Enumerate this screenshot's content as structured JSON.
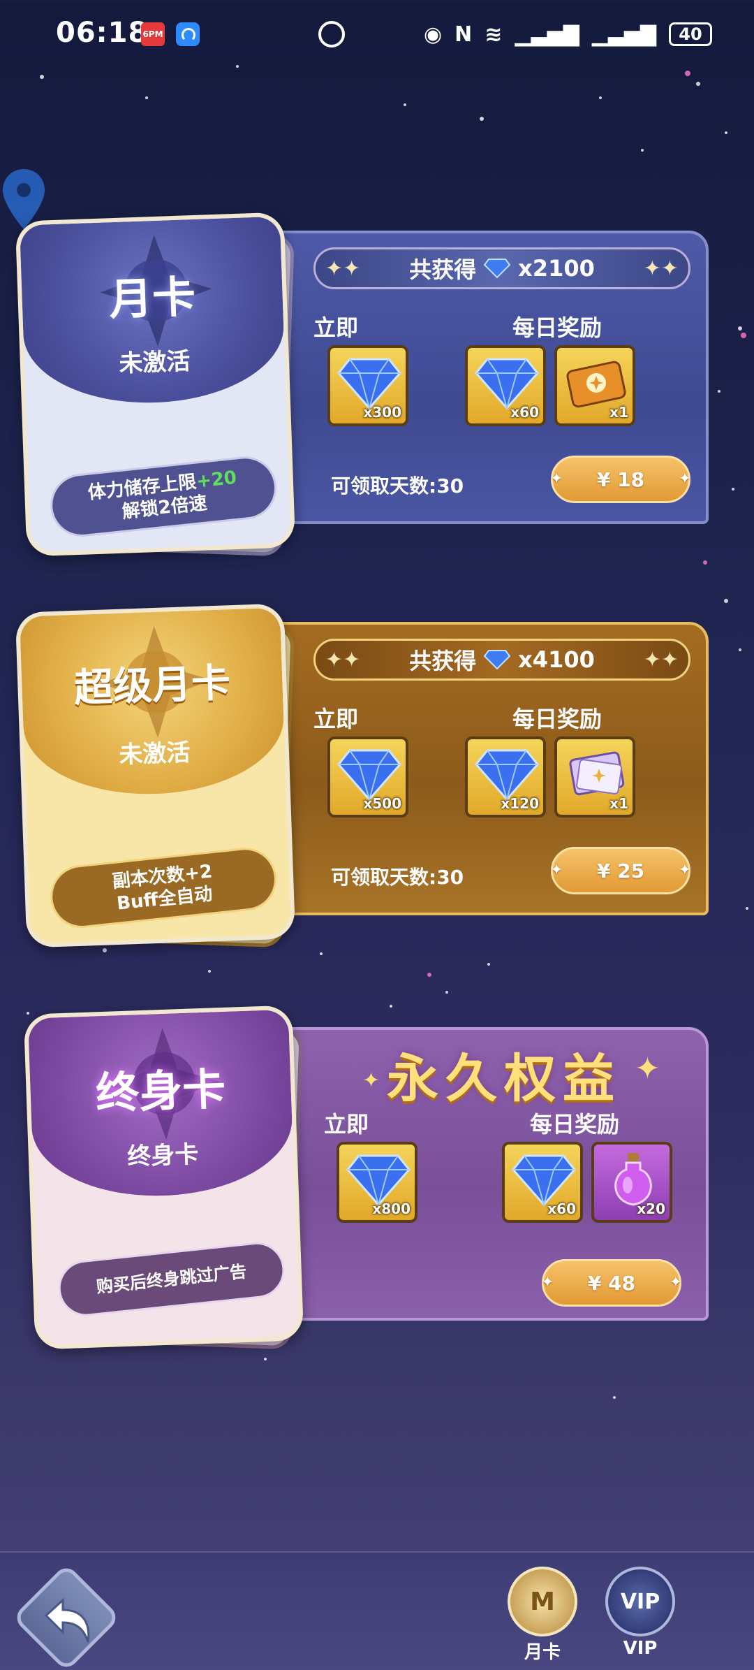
{
  "status_bar": {
    "time": "06:18",
    "battery": "40",
    "icons": [
      "eye-icon",
      "nfc-icon",
      "wifi-icon",
      "signal-4g-icon",
      "signal-4g-icon"
    ]
  },
  "cards": [
    {
      "id": "monthly",
      "title": "月卡",
      "status": "未激活",
      "perk_line1": "体力储存上限",
      "perk_highlight": "+20",
      "perk_line2": "解锁2倍速",
      "total_label": "共获得",
      "total_value": "x2100",
      "instant_label": "立即",
      "daily_label": "每日奖励",
      "instant_items": [
        {
          "icon": "diamond-icon",
          "qty": "x300"
        }
      ],
      "daily_items": [
        {
          "icon": "diamond-icon",
          "qty": "x60"
        },
        {
          "icon": "ticket-icon",
          "qty": "x1"
        }
      ],
      "days_text": "可领取天数:30",
      "price": "¥ 18"
    },
    {
      "id": "super-monthly",
      "title": "超级月卡",
      "status": "未激活",
      "perk_line1": "副本次数+2",
      "perk_line2": "Buff全自动",
      "total_label": "共获得",
      "total_value": "x4100",
      "instant_label": "立即",
      "daily_label": "每日奖励",
      "instant_items": [
        {
          "icon": "diamond-icon",
          "qty": "x500"
        }
      ],
      "daily_items": [
        {
          "icon": "diamond-icon",
          "qty": "x120"
        },
        {
          "icon": "card-ticket-icon",
          "qty": "x1"
        }
      ],
      "days_text": "可领取天数:30",
      "price": "¥ 25"
    },
    {
      "id": "lifetime",
      "title": "终身卡",
      "status": "终身卡",
      "perk_line1": "购买后终身跳过广告",
      "banner": "永久权益",
      "instant_label": "立即",
      "daily_label": "每日奖励",
      "instant_items": [
        {
          "icon": "diamond-icon",
          "qty": "x800"
        }
      ],
      "daily_items": [
        {
          "icon": "diamond-icon",
          "qty": "x60"
        },
        {
          "icon": "potion-icon",
          "qty": "x20"
        }
      ],
      "price": "¥ 48"
    }
  ],
  "bottom_nav": {
    "monthly_label": "月卡",
    "monthly_badge": "M",
    "vip_label": "VIP",
    "vip_badge": "VIP"
  },
  "colors": {
    "background": "#1f2450",
    "monthly_panel": "#4e5aa8",
    "super_panel": "#a46c22",
    "lifetime_panel": "#8e62ad",
    "price_button": "#e29a34"
  }
}
